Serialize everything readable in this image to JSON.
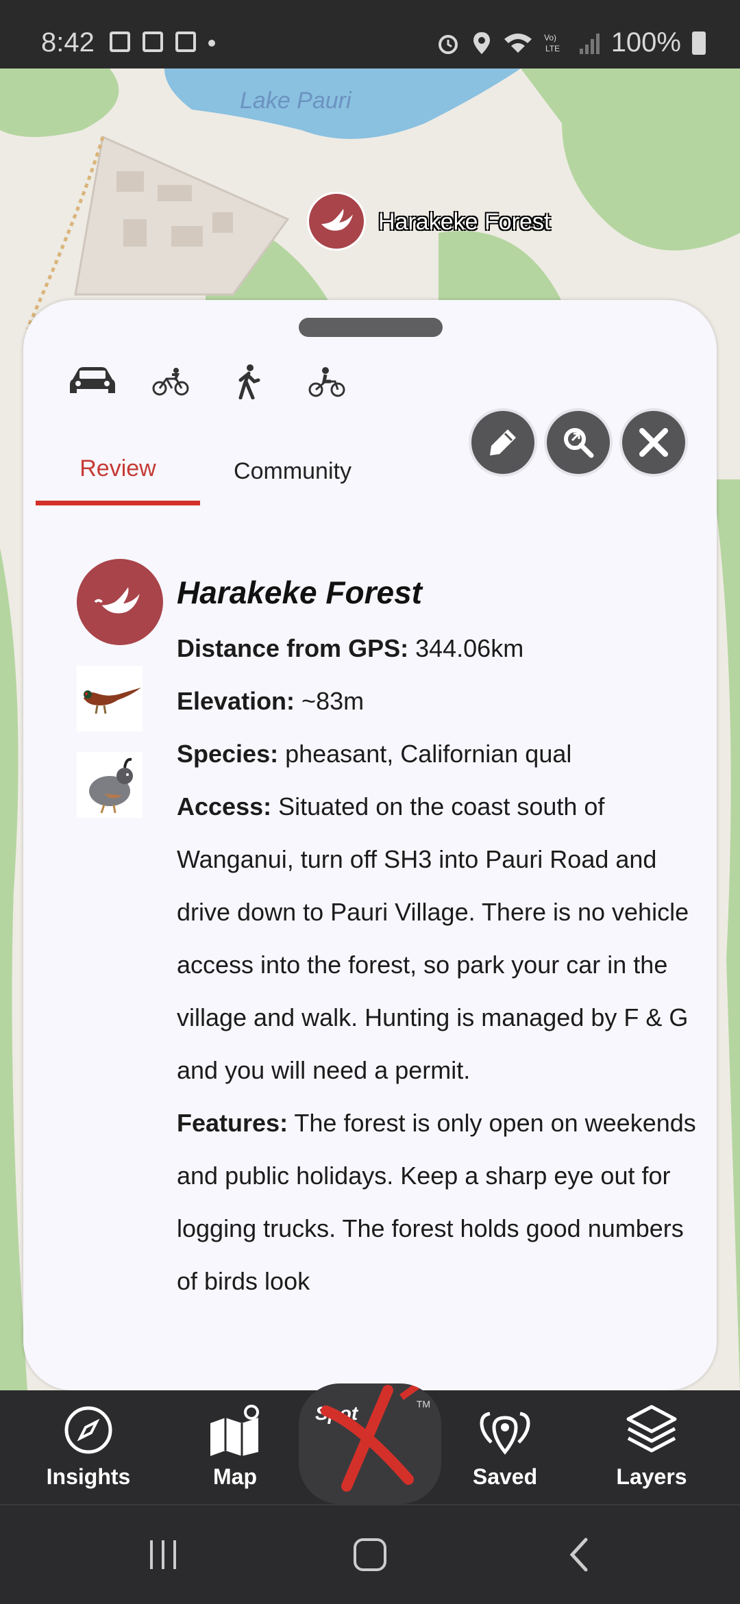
{
  "status_bar": {
    "time": "8:42",
    "battery": "100%",
    "icons": [
      "image-icon",
      "voicemail-icon",
      "gmail-icon",
      "alarm-icon",
      "location-icon",
      "wifi-icon",
      "volte-icon",
      "signal-icon",
      "battery-icon"
    ]
  },
  "map": {
    "lake_label": "Lake Pauri",
    "pin_label": "Harakeke Forest"
  },
  "sheet": {
    "tabs": [
      {
        "label": "Review",
        "active": true
      },
      {
        "label": "Community",
        "active": false
      }
    ],
    "transport_modes": [
      "car-icon",
      "bicycle-icon",
      "walk-icon",
      "motorbike-icon"
    ],
    "actions": [
      "edit-icon",
      "navigate-icon",
      "close-icon"
    ],
    "title": "Harakeke Forest",
    "fields": {
      "distance_label": "Distance from GPS:",
      "distance_value": " 344.06km",
      "elevation_label": "Elevation:",
      "elevation_value": " ~83m",
      "species_label": "Species:",
      "species_value": " pheasant, Californian qual",
      "access_label": "Access:",
      "access_value": " Situated on the coast south of Wanganui, turn off SH3 into Pauri Road and drive down to Pauri Village. There is no vehicle access into the forest, so park your car in the village and walk. Hunting is managed by F & G and you will need a permit.",
      "features_label": "Features:",
      "features_value": " The forest is only open on weekends and public holidays. Keep a sharp eye out for logging trucks. The forest holds good numbers of birds look"
    }
  },
  "bottom_nav": {
    "insights": "Insights",
    "map": "Map",
    "brand": "Spot",
    "brand_tm": "TM",
    "saved": "Saved",
    "layers": "Layers"
  },
  "colors": {
    "accent_red": "#d4302a",
    "pin": "#a8444a",
    "sheet_bg": "#f7f7fd",
    "nav_bg": "#2b2b2d"
  }
}
